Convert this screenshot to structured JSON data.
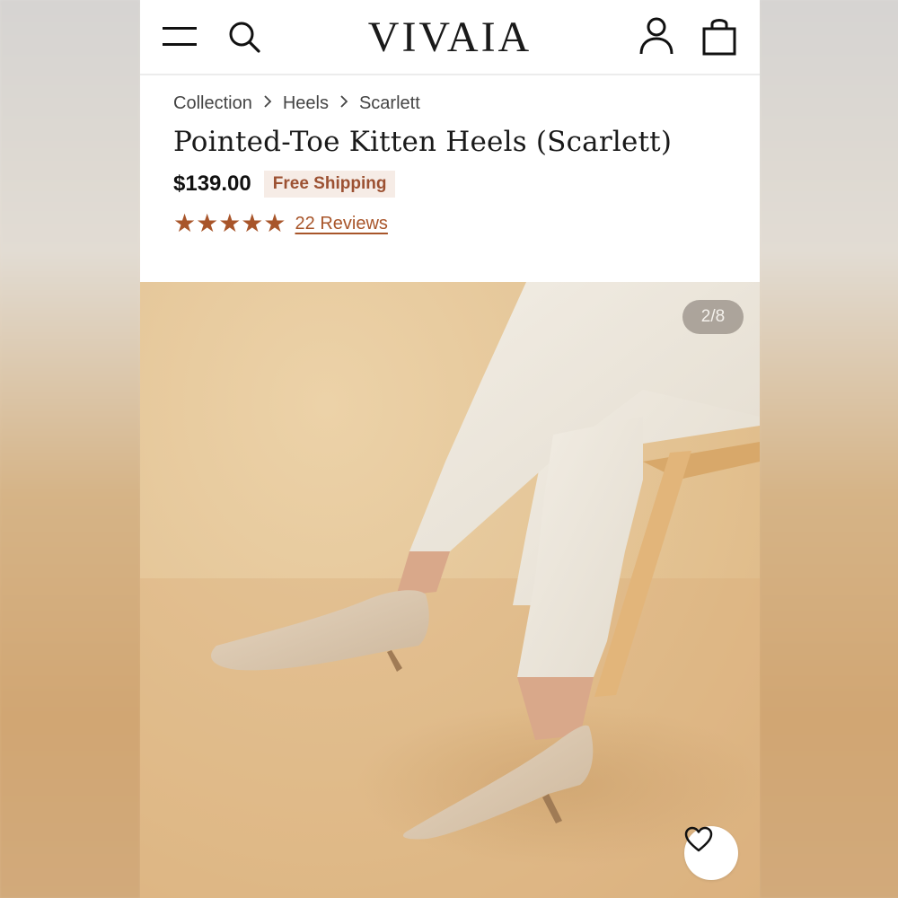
{
  "header": {
    "logo": "VIVAIA"
  },
  "breadcrumb": {
    "items": [
      "Collection",
      "Heels",
      "Scarlett"
    ],
    "separator": ">"
  },
  "product": {
    "title": "Pointed-Toe Kitten Heels (Scarlett)",
    "price": "$139.00",
    "shipping_badge": "Free Shipping",
    "stars_text": "★★★★★",
    "rating": 5,
    "reviews_label": "22 Reviews"
  },
  "gallery": {
    "counter": "2/8",
    "current_image": 2,
    "total_images": 8
  },
  "colors": {
    "accent": "#a8552a",
    "badge_bg": "#f6ece6",
    "badge_text": "#9c5132"
  },
  "icons": [
    "menu-icon",
    "search-icon",
    "account-icon",
    "bag-icon",
    "heart-icon",
    "star-icon",
    "chevron-right-icon"
  ]
}
